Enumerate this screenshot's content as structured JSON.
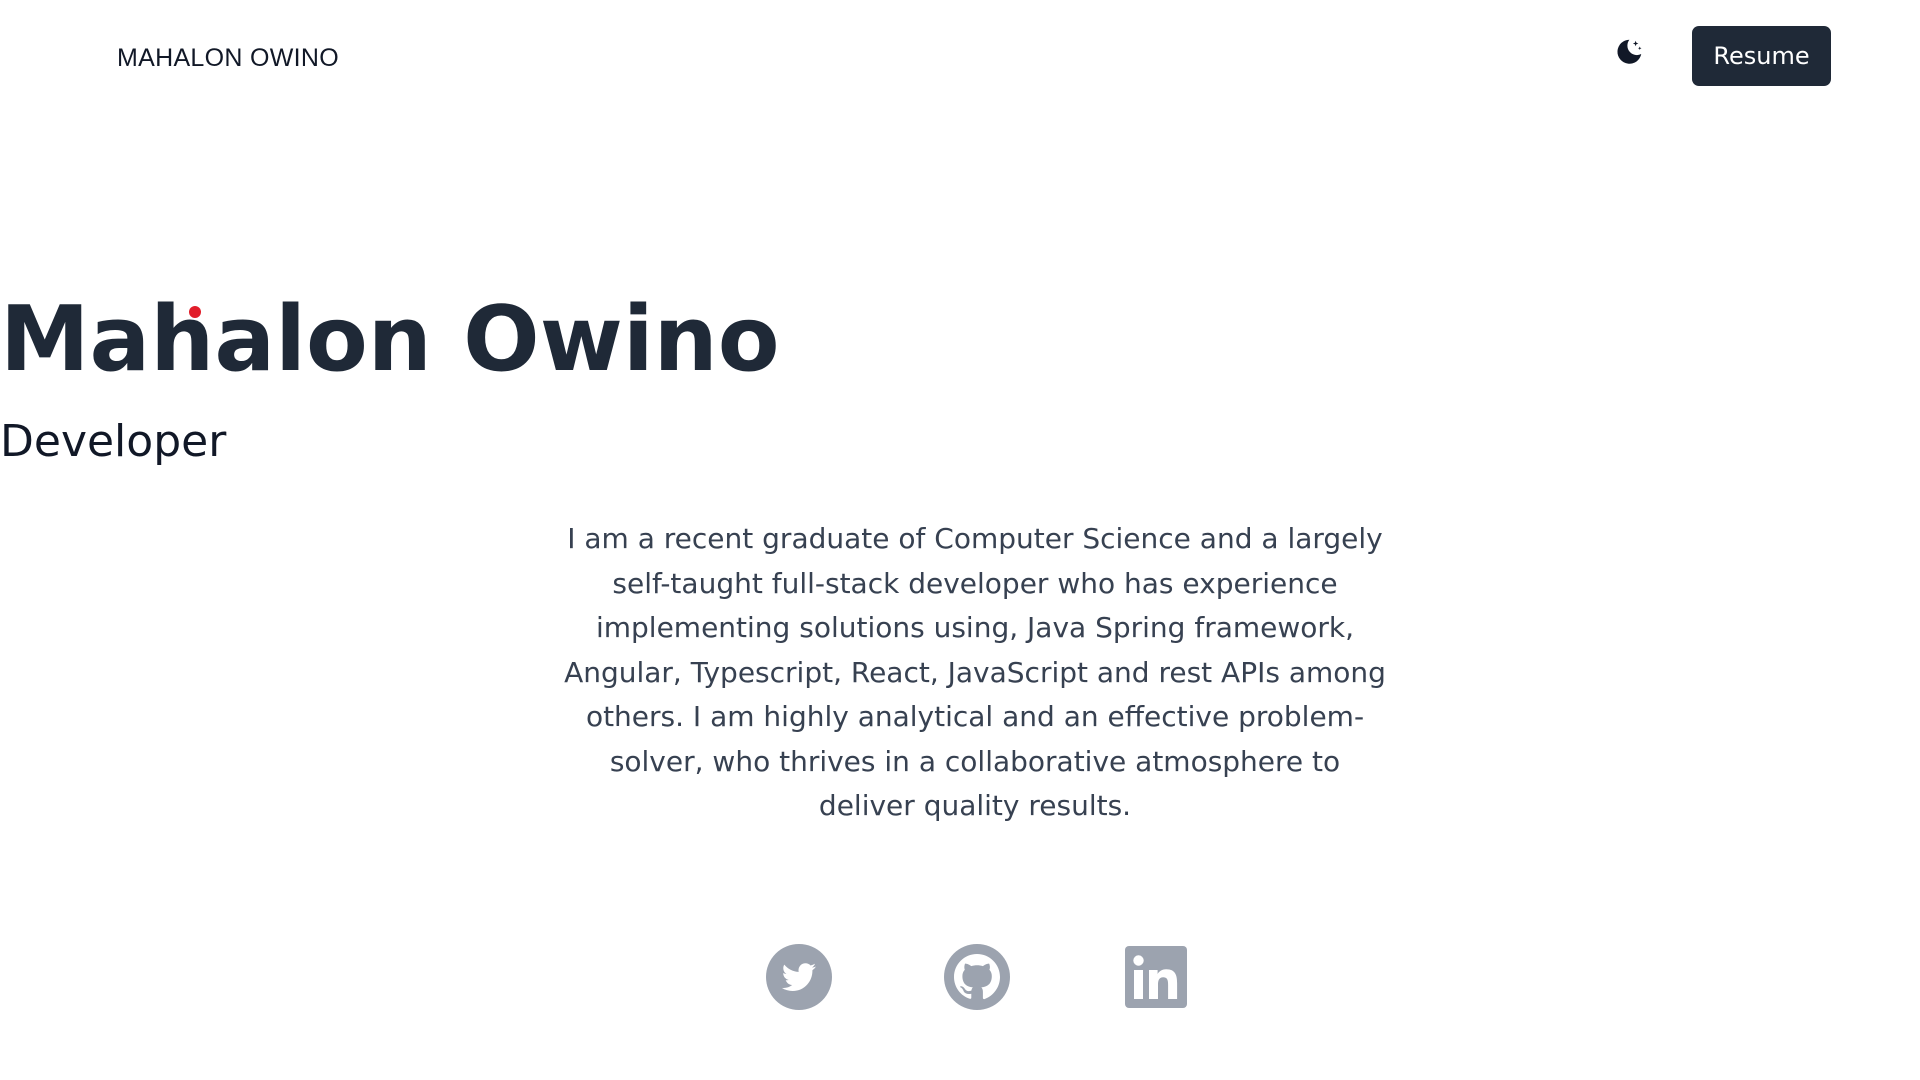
{
  "header": {
    "brand": "MAHALON OWINO",
    "theme_toggle_icon": "moon-stars-icon",
    "resume_label": "Resume"
  },
  "hero": {
    "name": "Mahalon Owino",
    "role": "Developer",
    "bio": "I am a recent graduate of Computer Science and a largely self-taught full-stack developer who has experience implementing solutions using, Java Spring framework, Angular, Typescript, React, JavaScript and rest APIs among others. I am highly analytical and an effective problem-solver, who thrives in a collaborative atmosphere to deliver quality results."
  },
  "social": [
    {
      "icon": "twitter-icon"
    },
    {
      "icon": "github-icon"
    },
    {
      "icon": "linkedin-icon"
    }
  ],
  "colors": {
    "primary": "#1f2937",
    "icon_gray": "#9ca3af",
    "cursor_dot": "#e11d2a"
  }
}
